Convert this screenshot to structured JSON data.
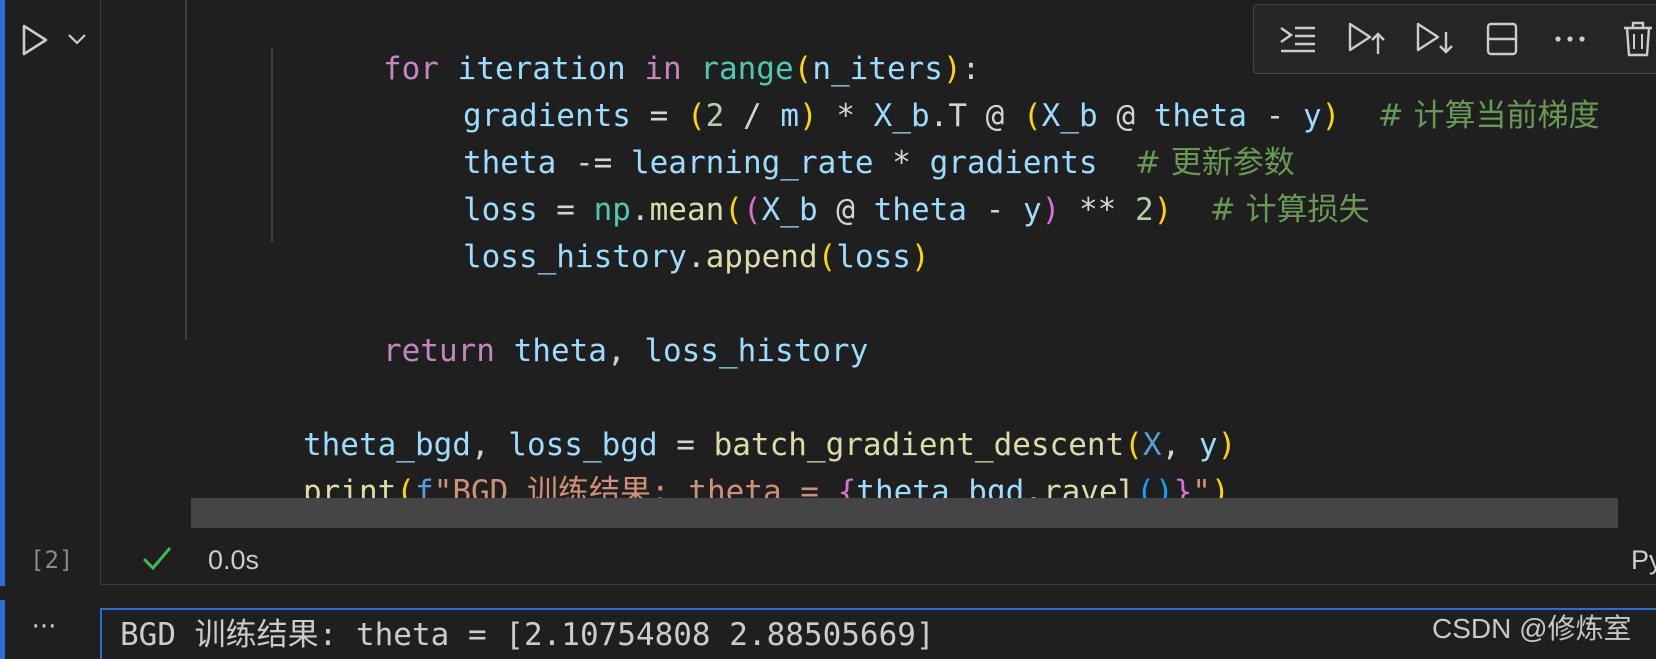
{
  "cell": {
    "execution_count": "[2]",
    "status_time": "0.0s",
    "kernel_label": "Py",
    "code_lines": {
      "l1": {
        "kw": "for",
        "var": "iteration",
        "kw2": "in",
        "fn": "range",
        "arg": "n_iters",
        "tail": ":"
      },
      "l2": {
        "a": "gradients",
        "b": " = ",
        "c": "2",
        "d": " / ",
        "e": "m",
        "f": " * ",
        "g": "X_b",
        "h": ".T @ ",
        "i": "X_b",
        "j": " @ ",
        "k": "theta",
        "l": " - ",
        "m": "y",
        "cmt": "# 计算当前梯度"
      },
      "l3": {
        "a": "theta",
        "b": " -= ",
        "c": "learning_rate",
        "d": " * ",
        "e": "gradients",
        "cmt": "# 更新参数"
      },
      "l4": {
        "a": "loss",
        "b": " = ",
        "c": "np",
        "d": ".",
        "e": "mean",
        "g": "X_b",
        "h": " @ ",
        "i": "theta",
        "j": " - ",
        "k": "y",
        "l": " ** ",
        "m": "2",
        "cmt": "# 计算损失"
      },
      "l5": {
        "a": "loss_history",
        "b": ".",
        "c": "append",
        "e": "loss"
      },
      "l6": {
        "kw": "return",
        "a": "theta",
        "b": ", ",
        "c": "loss_history"
      },
      "l7": {
        "a": "theta_bgd",
        "b": ", ",
        "c": "loss_bgd",
        "d": " = ",
        "e": "batch_gradient_descent",
        "g": "X",
        "h": ", ",
        "i": "y"
      },
      "l8": {
        "a": "print",
        "f": "f",
        "s1": "\"BGD 训练结果: theta = ",
        "c": "theta_bgd",
        "d": ".",
        "e": "ravel",
        "s2": "\""
      }
    }
  },
  "toolbar": {
    "buttons": [
      "run-by-line-icon",
      "execute-above-icon",
      "execute-below-icon",
      "split-cell-icon",
      "more-icon",
      "delete-icon"
    ]
  },
  "output": {
    "menu": "···",
    "text_prefix": "BGD ",
    "text_cjk": "训练结果",
    "text_suffix": ": theta = [2.10754808 2.88505669]"
  },
  "watermark": "CSDN @修炼室",
  "colors": {
    "accent": "#2b6cd6",
    "background": "#1f1f1f",
    "success_check": "#3fb950"
  }
}
